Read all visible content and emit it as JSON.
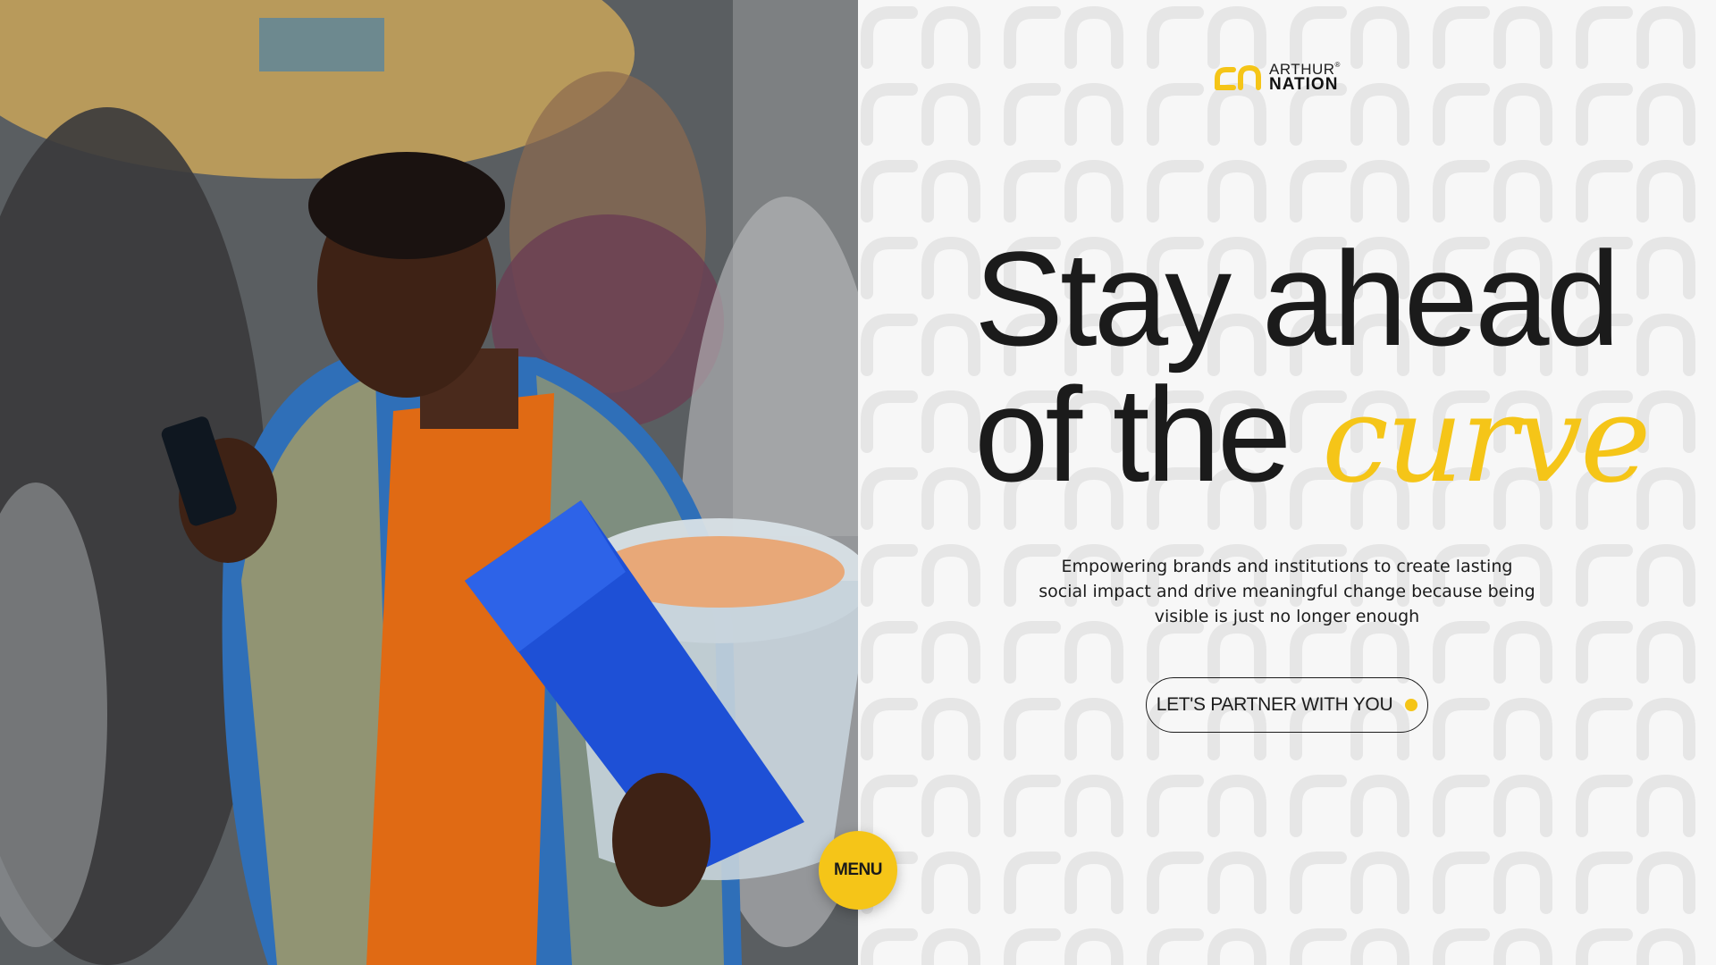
{
  "hero_image": {
    "alt_icon": "photo-person-with-phone-icon"
  },
  "logo": {
    "icon": "arthur-nation-logo-icon",
    "top": "ARTHUR",
    "mark": "®",
    "bottom": "NATION"
  },
  "headline": {
    "line1": "Stay ahead",
    "line2_plain": "of the ",
    "line2_accent": "curve"
  },
  "subtext": "Empowering brands and institutions to create lasting social impact and drive meaningful change because being visible is just no longer enough",
  "cta": {
    "label": "LET'S PARTNER WITH YOU",
    "dot_icon": "yellow-dot-icon"
  },
  "menu": {
    "label": "MENU"
  },
  "colors": {
    "accent": "#f5c518",
    "text": "#1b1b1b",
    "background": "#f7f7f7"
  }
}
